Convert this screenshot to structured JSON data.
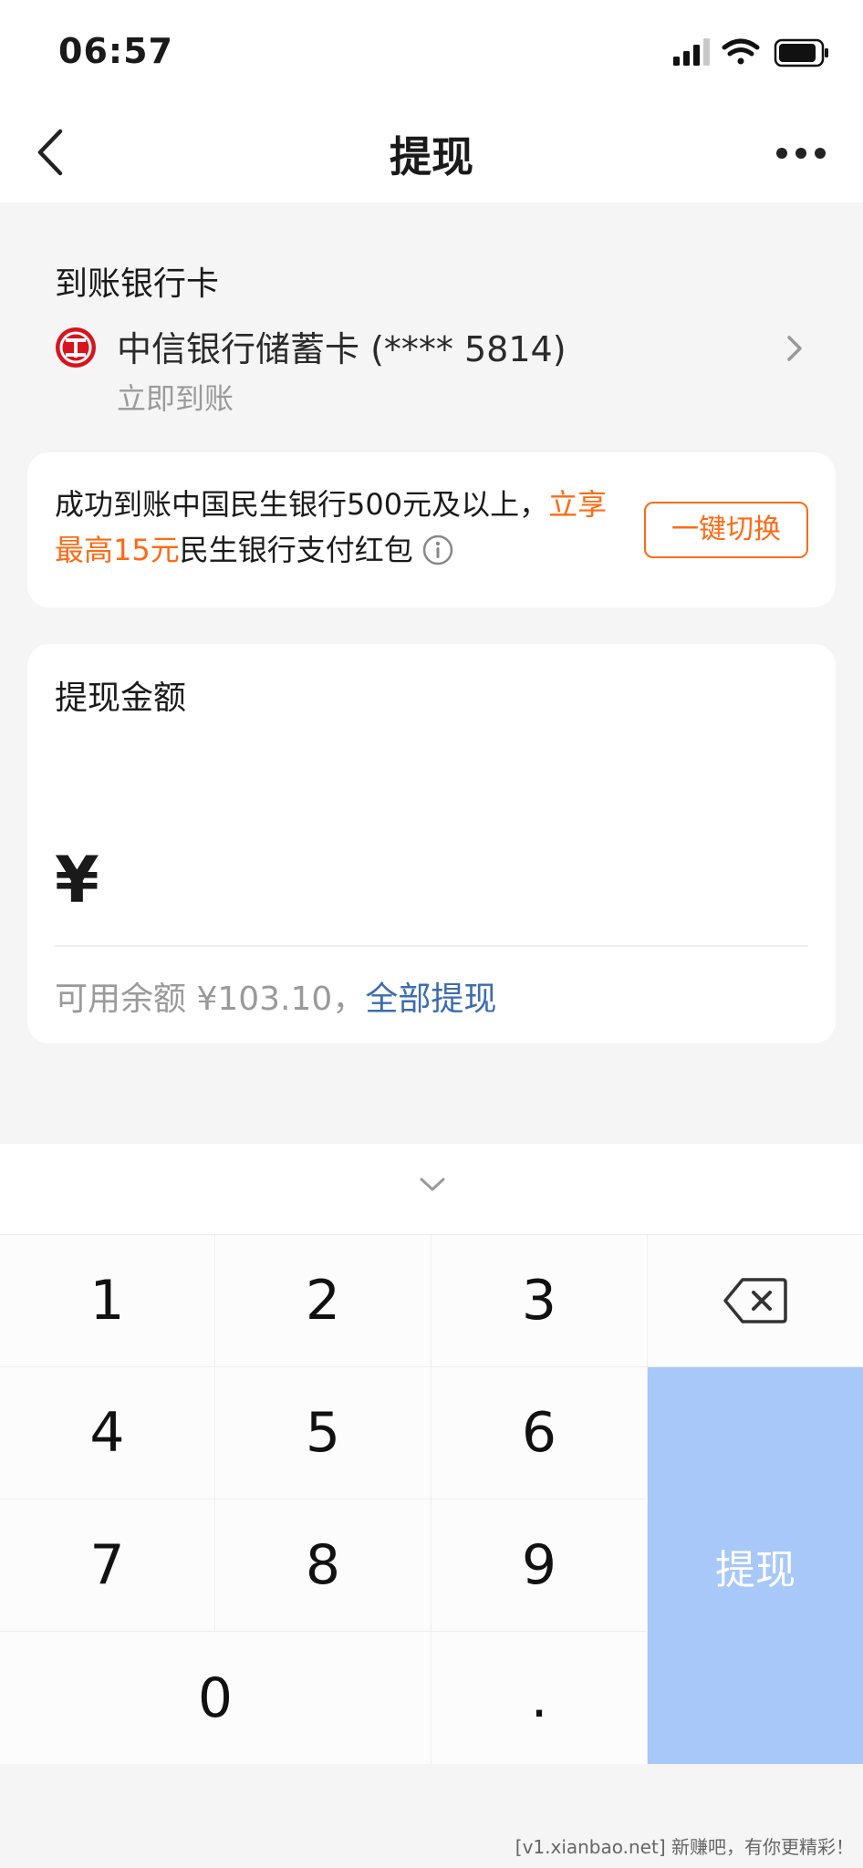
{
  "status_bar": {
    "time": "06:57"
  },
  "nav": {
    "title": "提现"
  },
  "bank_section": {
    "label": "到账银行卡",
    "bank_name": "中信银行储蓄卡 (**** 5814)",
    "arrival": "立即到账"
  },
  "promo": {
    "text_pre": "成功到账中国民生银行500元及以上，",
    "text_highlight": "立享最高15元",
    "text_post": "民生银行支付红包",
    "button_label": "一键切换",
    "highlight_color": "#ff6a14"
  },
  "amount": {
    "label": "提现金额",
    "currency": "¥",
    "value": "",
    "balance_text": "可用余额 ¥103.10，",
    "withdraw_all": "全部提现"
  },
  "keypad": {
    "keys": [
      "1",
      "2",
      "3",
      "4",
      "5",
      "6",
      "7",
      "8",
      "9",
      "0",
      "."
    ],
    "submit_label": "提现",
    "submit_color": "#a7c8f8"
  },
  "footer": {
    "note": "[v1.xianbao.net] 新赚吧，有你更精彩！"
  }
}
